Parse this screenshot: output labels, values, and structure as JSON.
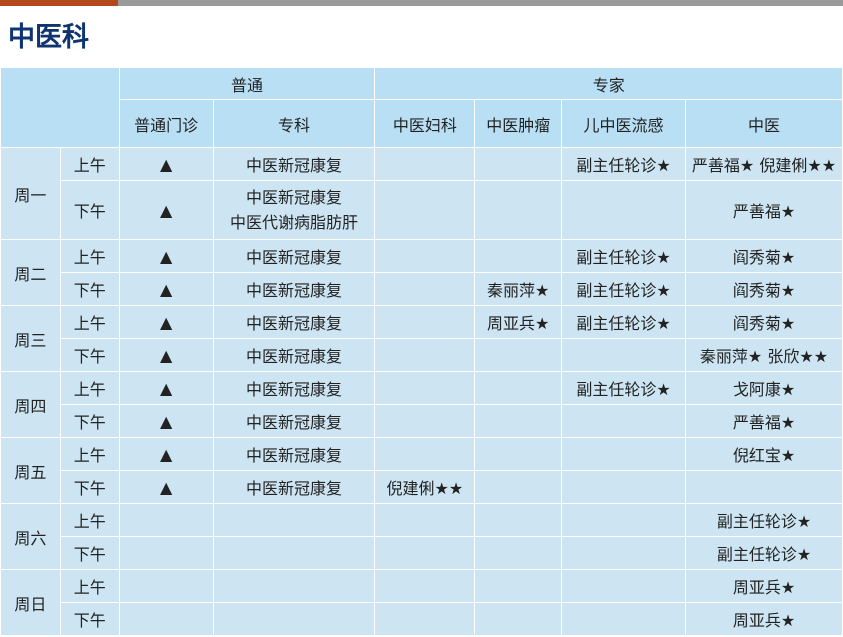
{
  "page_title": "中医科",
  "header": {
    "group_putong": "普通",
    "group_zhuanjia": "专家",
    "col_putong_menzhen": "普通门诊",
    "col_zhuanke": "专科",
    "col_fuke": "中医妇科",
    "col_zhongliu": "中医肿瘤",
    "col_erke": "儿中医流感",
    "col_zhongyi": "中医"
  },
  "symbols": {
    "triangle": "▲"
  },
  "days": [
    {
      "day": "周一",
      "am": {
        "label": "上午",
        "putong": "▲",
        "zhuanke": "中医新冠康复",
        "fuke": "",
        "zhongliu": "",
        "erke": "副主任轮诊★",
        "zhongyi": "严善福★  倪建俐★★"
      },
      "pm": {
        "label": "下午",
        "putong": "▲",
        "zhuanke": "中医新冠康复",
        "zhuanke2": "中医代谢病脂肪肝",
        "fuke": "",
        "zhongliu": "",
        "erke": "",
        "zhongyi": "严善福★"
      }
    },
    {
      "day": "周二",
      "am": {
        "label": "上午",
        "putong": "▲",
        "zhuanke": "中医新冠康复",
        "fuke": "",
        "zhongliu": "",
        "erke": "副主任轮诊★",
        "zhongyi": "阎秀菊★"
      },
      "pm": {
        "label": "下午",
        "putong": "▲",
        "zhuanke": "中医新冠康复",
        "fuke": "",
        "zhongliu": "秦丽萍★",
        "erke": "副主任轮诊★",
        "zhongyi": "阎秀菊★"
      }
    },
    {
      "day": "周三",
      "am": {
        "label": "上午",
        "putong": "▲",
        "zhuanke": "中医新冠康复",
        "fuke": "",
        "zhongliu": "周亚兵★",
        "erke": "副主任轮诊★",
        "zhongyi": "阎秀菊★"
      },
      "pm": {
        "label": "下午",
        "putong": "▲",
        "zhuanke": "中医新冠康复",
        "fuke": "",
        "zhongliu": "",
        "erke": "",
        "zhongyi": "秦丽萍★  张欣★★"
      }
    },
    {
      "day": "周四",
      "am": {
        "label": "上午",
        "putong": "▲",
        "zhuanke": "中医新冠康复",
        "fuke": "",
        "zhongliu": "",
        "erke": "副主任轮诊★",
        "zhongyi": "戈阿康★"
      },
      "pm": {
        "label": "下午",
        "putong": "▲",
        "zhuanke": "中医新冠康复",
        "fuke": "",
        "zhongliu": "",
        "erke": "",
        "zhongyi": "严善福★"
      }
    },
    {
      "day": "周五",
      "am": {
        "label": "上午",
        "putong": "▲",
        "zhuanke": "中医新冠康复",
        "fuke": "",
        "zhongliu": "",
        "erke": "",
        "zhongyi": "倪红宝★"
      },
      "pm": {
        "label": "下午",
        "putong": "▲",
        "zhuanke": "中医新冠康复",
        "fuke": "倪建俐★★",
        "zhongliu": "",
        "erke": "",
        "zhongyi": ""
      }
    },
    {
      "day": "周六",
      "am": {
        "label": "上午",
        "putong": "",
        "zhuanke": "",
        "fuke": "",
        "zhongliu": "",
        "erke": "",
        "zhongyi": "副主任轮诊★"
      },
      "pm": {
        "label": "下午",
        "putong": "",
        "zhuanke": "",
        "fuke": "",
        "zhongliu": "",
        "erke": "",
        "zhongyi": "副主任轮诊★"
      }
    },
    {
      "day": "周日",
      "am": {
        "label": "上午",
        "putong": "",
        "zhuanke": "",
        "fuke": "",
        "zhongliu": "",
        "erke": "",
        "zhongyi": "周亚兵★"
      },
      "pm": {
        "label": "下午",
        "putong": "",
        "zhuanke": "",
        "fuke": "",
        "zhongliu": "",
        "erke": "",
        "zhongyi": "周亚兵★"
      }
    }
  ]
}
